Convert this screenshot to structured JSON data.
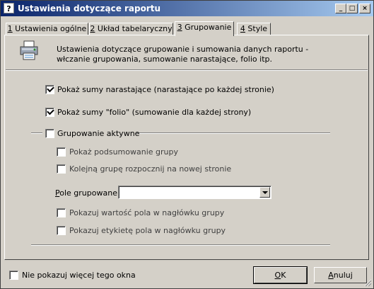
{
  "window": {
    "title": "Ustawienia dotyczące raportu",
    "controls": {
      "minimize": "_",
      "maximize": "□",
      "close": "×"
    }
  },
  "tabs": [
    {
      "key": "1",
      "label": " Ustawienia ogólne"
    },
    {
      "key": "2",
      "label": " Układ tabelaryczny"
    },
    {
      "key": "3",
      "label": " Grupowanie"
    },
    {
      "key": "4",
      "label": " Style"
    }
  ],
  "active_tab": 2,
  "header": {
    "icon": "printer-icon",
    "description": "Ustawienia dotyczące grupowanie i sumowania danych raportu - włczanie grupowania, sumowanie narastające, folio itp."
  },
  "options": {
    "running_totals": {
      "label": "Pokaż sumy narastające (narastające po każdej stronie)",
      "checked": true
    },
    "folio_totals": {
      "label": "Pokaż sumy \"folio\" (sumowanie dla każdej strony)",
      "checked": true
    },
    "grouping_active": {
      "label": "Grupowanie aktywne",
      "checked": false
    }
  },
  "grouping": {
    "show_group_summary": {
      "label": "Pokaż podsumowanie grupy",
      "checked": false
    },
    "new_page_per_group": {
      "label": "Kolejną grupę rozpocznij na nowej stronie",
      "checked": false
    },
    "group_field_label_key": "P",
    "group_field_label_rest": "ole grupowane:",
    "group_field_value": "",
    "show_field_value_in_header": {
      "label": "Pokazuj wartość pola w nagłówku grupy",
      "checked": false
    },
    "show_field_label_in_header": {
      "label": "Pokazuj etykietę pola w nagłówku grupy",
      "checked": false
    }
  },
  "footer": {
    "dont_show_again": {
      "label": "Nie pokazuj więcej tego okna",
      "checked": false
    },
    "ok_key": "O",
    "ok_rest": "K",
    "cancel_key": "A",
    "cancel_rest": "nuluj"
  },
  "colors": {
    "titlebar_start": "#0a246a",
    "titlebar_end": "#a6caf0",
    "face": "#d4d0c8"
  }
}
